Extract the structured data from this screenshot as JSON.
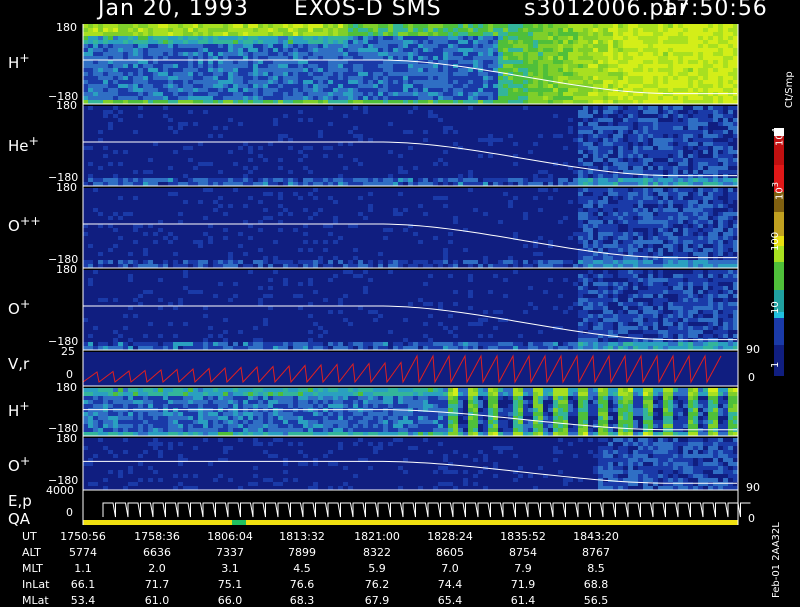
{
  "header": {
    "date": "Jan 20, 1993",
    "instrument": "EXOS-D SMS",
    "file": "s3012006.par",
    "time": "17:50:56"
  },
  "colorbar": {
    "unit": "Ct/Smp",
    "tick_labels": [
      "1",
      "10",
      "100",
      "10",
      "3",
      "10",
      "4"
    ]
  },
  "panel_labels": {
    "h_plus": "H",
    "h_plus_sup": "+",
    "he_plus": "He",
    "he_plus_sup": "+",
    "o_pp": "O",
    "o_pp_sup": "++",
    "o_plus": "O",
    "o_plus_sup": "+",
    "vr": "V,r",
    "h_plus2": "H",
    "h_plus2_sup": "+",
    "o_plus2": "O",
    "o_plus2_sup": "+",
    "ep": "E,p",
    "qa": "QA"
  },
  "axis_ticks": {
    "p1_top": "180",
    "p1_bot": "−180",
    "p2_top": "180",
    "p2_bot": "−180",
    "p3_top": "180",
    "p3_bot": "−180",
    "p4_top": "180",
    "p4_bot": "−180",
    "vr_top": "25",
    "vr_bot": "0",
    "p6_top": "180",
    "p6_bot": "−180",
    "p7_top": "180",
    "p7_bot": "−180",
    "ep_top": "4000",
    "ep_bot": "0",
    "r_90a": "90",
    "r_0a": "0",
    "r_90b": "90",
    "r_0b": "0"
  },
  "footer": {
    "side_note": "Feb-01 2AA32L",
    "row_labels": [
      "UT",
      "ALT",
      "MLT",
      "InLat",
      "MLat"
    ],
    "columns": [
      {
        "ut": "1750:56",
        "alt": "5774",
        "mlt": "1.1",
        "inlat": "66.1",
        "mlat": "53.4"
      },
      {
        "ut": "1758:36",
        "alt": "6636",
        "mlt": "2.0",
        "inlat": "71.7",
        "mlat": "61.0"
      },
      {
        "ut": "1806:04",
        "alt": "7337",
        "mlt": "3.1",
        "inlat": "75.1",
        "mlat": "66.0"
      },
      {
        "ut": "1813:32",
        "alt": "7899",
        "mlt": "4.5",
        "inlat": "76.6",
        "mlat": "68.3"
      },
      {
        "ut": "1821:00",
        "alt": "8322",
        "mlt": "5.9",
        "inlat": "76.2",
        "mlat": "67.9"
      },
      {
        "ut": "1828:24",
        "alt": "8605",
        "mlt": "7.0",
        "inlat": "74.4",
        "mlat": "65.4"
      },
      {
        "ut": "1835:52",
        "alt": "8754",
        "mlt": "7.9",
        "inlat": "71.9",
        "mlat": "61.4"
      },
      {
        "ut": "1843:20",
        "alt": "8767",
        "mlt": "8.5",
        "inlat": "68.8",
        "mlat": "56.5"
      }
    ]
  },
  "chart_data": {
    "type": "heatmap",
    "time_ticks": [
      "1750:56",
      "1758:36",
      "1806:04",
      "1813:32",
      "1821:00",
      "1828:24",
      "1835:52",
      "1843:20"
    ],
    "pitch_angle_range": [
      -180,
      180
    ],
    "color_scale": {
      "type": "log",
      "range": [
        1,
        10000
      ]
    },
    "panels": [
      {
        "species": "H+",
        "ylim": [
          -180,
          180
        ],
        "overall_intensity": "high",
        "note": "intense green fluxes after ~1828"
      },
      {
        "species": "He+",
        "ylim": [
          -180,
          180
        ],
        "overall_intensity": "low"
      },
      {
        "species": "O++",
        "ylim": [
          -180,
          180
        ],
        "overall_intensity": "low"
      },
      {
        "species": "O+",
        "ylim": [
          -180,
          180
        ],
        "overall_intensity": "low"
      },
      {
        "species": "V,r",
        "ylim": [
          0,
          25
        ],
        "right_ylim": [
          0,
          90
        ],
        "type": "line"
      },
      {
        "species": "H+",
        "ylim": [
          -180,
          180
        ],
        "overall_intensity": "moderate"
      },
      {
        "species": "O+",
        "ylim": [
          -180,
          180
        ],
        "right_ylim": [
          0,
          90
        ],
        "overall_intensity": "low"
      },
      {
        "species": "E,p",
        "ylim": [
          0,
          4000
        ],
        "type": "line"
      }
    ]
  }
}
